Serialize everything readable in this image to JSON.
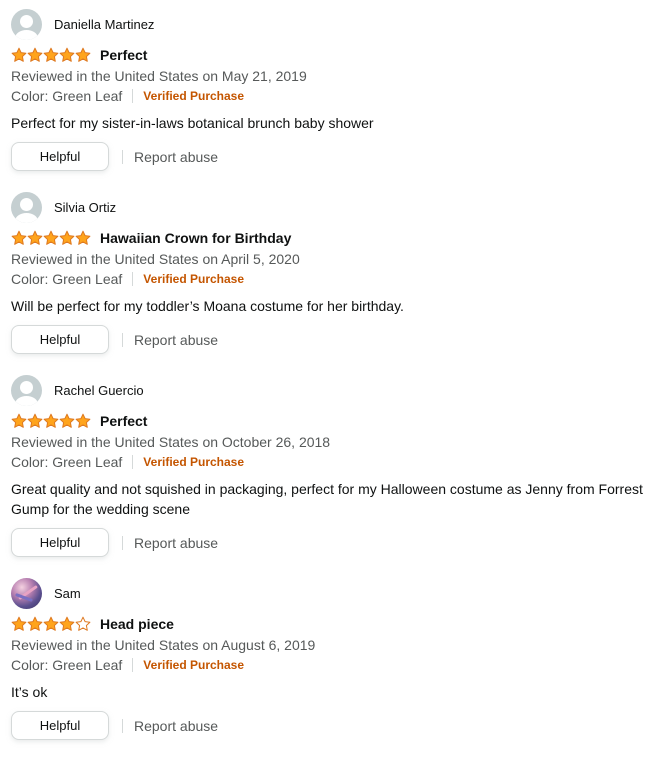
{
  "colors": {
    "star_fill": "#ffa41c",
    "star_stroke": "#de7921",
    "verified": "#c45500",
    "meta_text": "#565959"
  },
  "reviews": [
    {
      "reviewer": "Daniella Martinez",
      "avatar": "default-avatar-icon",
      "rating": 5,
      "title": "Perfect",
      "date_line": "Reviewed in the United States on May 21, 2019",
      "variant": "Color: Green Leaf",
      "verified": "Verified Purchase",
      "body": "Perfect for my sister-in-laws botanical brunch baby shower",
      "helpful_label": "Helpful",
      "report_label": "Report abuse"
    },
    {
      "reviewer": "Silvia Ortiz",
      "avatar": "default-avatar-icon",
      "rating": 5,
      "title": "Hawaiian Crown for Birthday",
      "date_line": "Reviewed in the United States on April 5, 2020",
      "variant": "Color: Green Leaf",
      "verified": "Verified Purchase",
      "body": "Will be perfect for my toddler’s Moana costume for her birthday.",
      "helpful_label": "Helpful",
      "report_label": "Report abuse"
    },
    {
      "reviewer": "Rachel Guercio",
      "avatar": "default-avatar-icon",
      "rating": 5,
      "title": "Perfect",
      "date_line": "Reviewed in the United States on October 26, 2018",
      "variant": "Color: Green Leaf",
      "verified": "Verified Purchase",
      "body": "Great quality and not squished in packaging, perfect for my Halloween costume as Jenny from Forrest Gump for the wedding scene",
      "helpful_label": "Helpful",
      "report_label": "Report abuse"
    },
    {
      "reviewer": "Sam",
      "avatar": "photo-avatar",
      "rating": 4,
      "title": "Head piece",
      "date_line": "Reviewed in the United States on August 6, 2019",
      "variant": "Color: Green Leaf",
      "verified": "Verified Purchase",
      "body": "It’s ok",
      "helpful_label": "Helpful",
      "report_label": "Report abuse"
    }
  ]
}
